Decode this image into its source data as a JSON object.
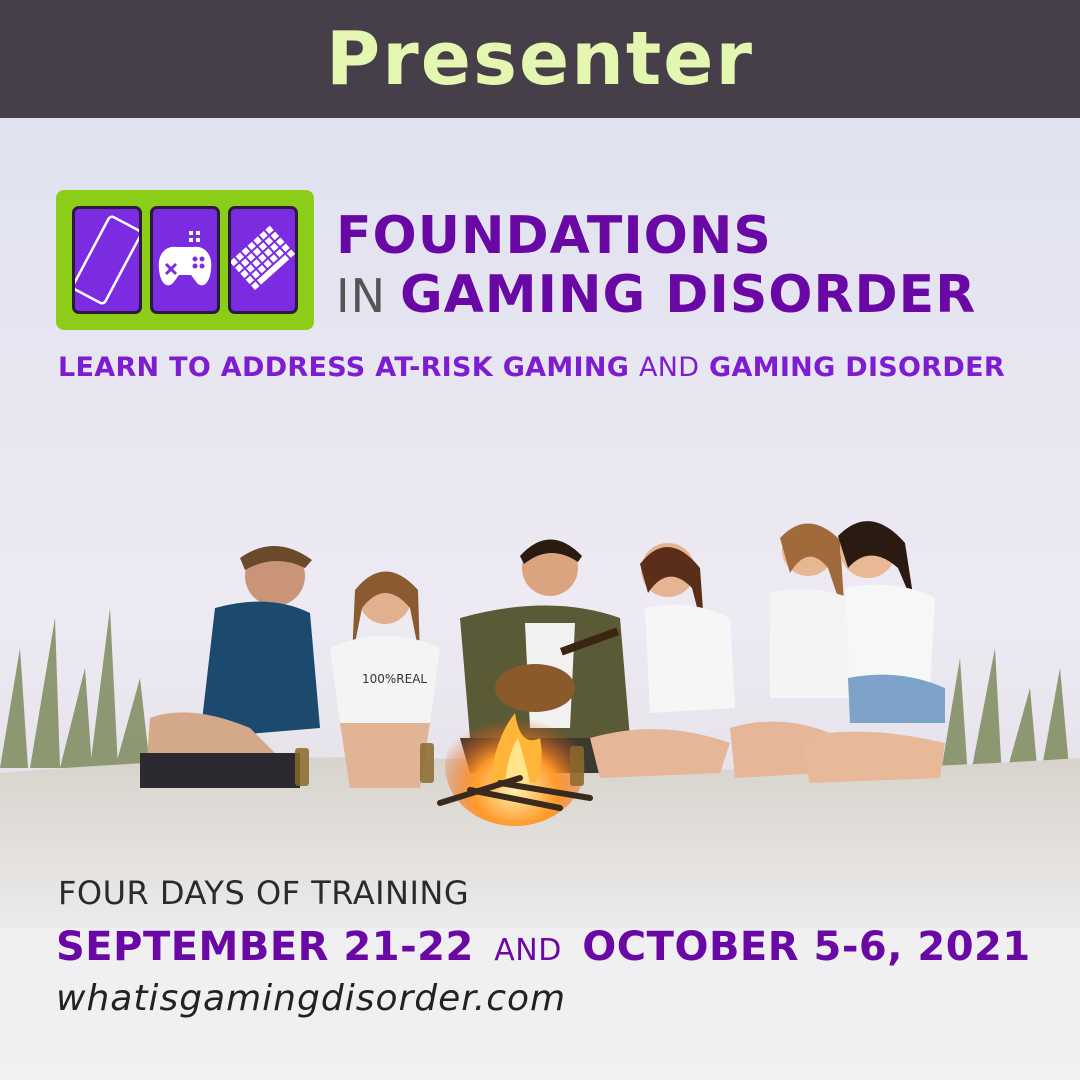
{
  "banner": {
    "title": "Presenter"
  },
  "logo": {
    "line1": "FOUNDATIONS",
    "line2_prefix": "IN",
    "line2": "GAMING DISORDER"
  },
  "subtitle": {
    "part1": "LEARN TO ADDRESS AT-RISK GAMING",
    "and": "AND",
    "part2": "GAMING DISORDER"
  },
  "photo": {
    "logo_text": "100%REAL"
  },
  "footer": {
    "days": "FOUR DAYS OF TRAINING",
    "dates_part1": "SEPTEMBER 21-22",
    "dates_and": "AND",
    "dates_part2": "OCTOBER 5-6, 2021",
    "url": "whatisgamingdisorder.com"
  },
  "colors": {
    "banner_bg": "#463f4a",
    "banner_text": "#e4f7b0",
    "purple": "#6a08a5",
    "logo_green": "#8ccd1a",
    "tile_purple": "#7b2ce0"
  },
  "icons": [
    "smartphone-icon",
    "gamepad-icon",
    "keyboard-icon"
  ]
}
